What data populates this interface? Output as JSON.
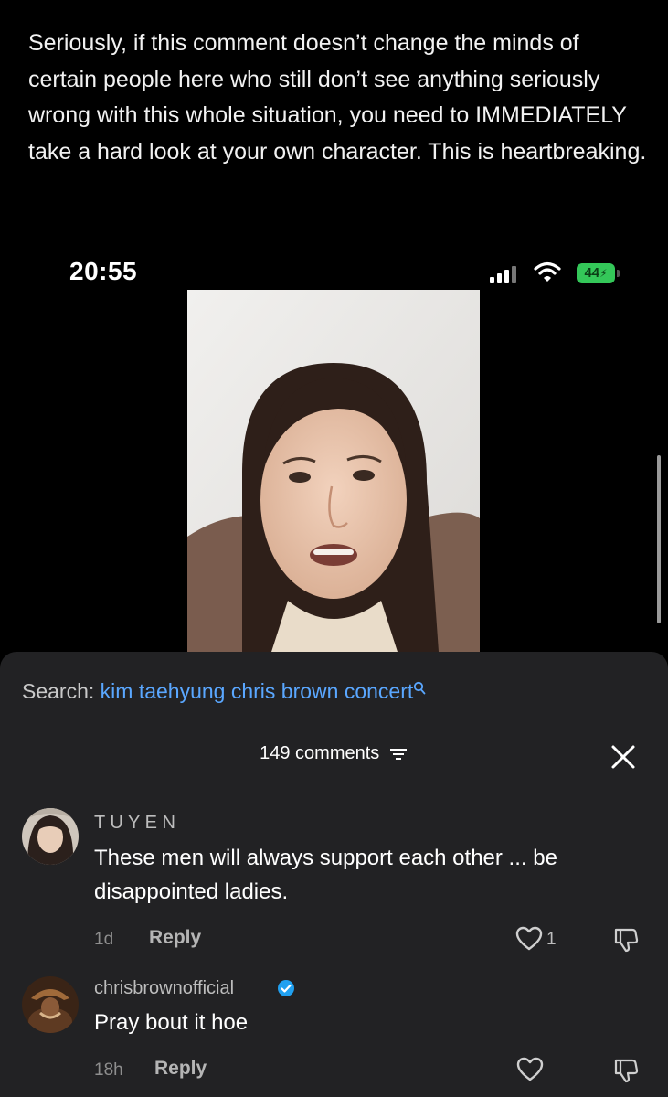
{
  "caption": "Seriously, if this comment doesn’t change the minds of certain people here who still don’t see anything seriously wrong with this whole situation, you need to IMMEDIATELY take a hard look at your own character. This is heartbreaking.",
  "status_bar": {
    "time": "20:55",
    "battery": "44"
  },
  "search": {
    "label": "Search:",
    "query": "kim taehyung chris brown concert"
  },
  "comments_header": {
    "count_label": "149 comments"
  },
  "comments": [
    {
      "username": "T U Y E N",
      "text": "These men will always support each other ... be disappointed ladies.",
      "age": "1d",
      "reply_label": "Reply",
      "likes": "1"
    },
    {
      "username": "chrisbrownofficial",
      "verified": true,
      "text": "Pray bout it hoe",
      "age": "18h",
      "reply_label": "Reply",
      "likes": ""
    }
  ],
  "colors": {
    "background": "#000000",
    "sheet": "#222224",
    "link": "#5aa7ff",
    "battery": "#34c759",
    "verified": "#20a0f0"
  }
}
